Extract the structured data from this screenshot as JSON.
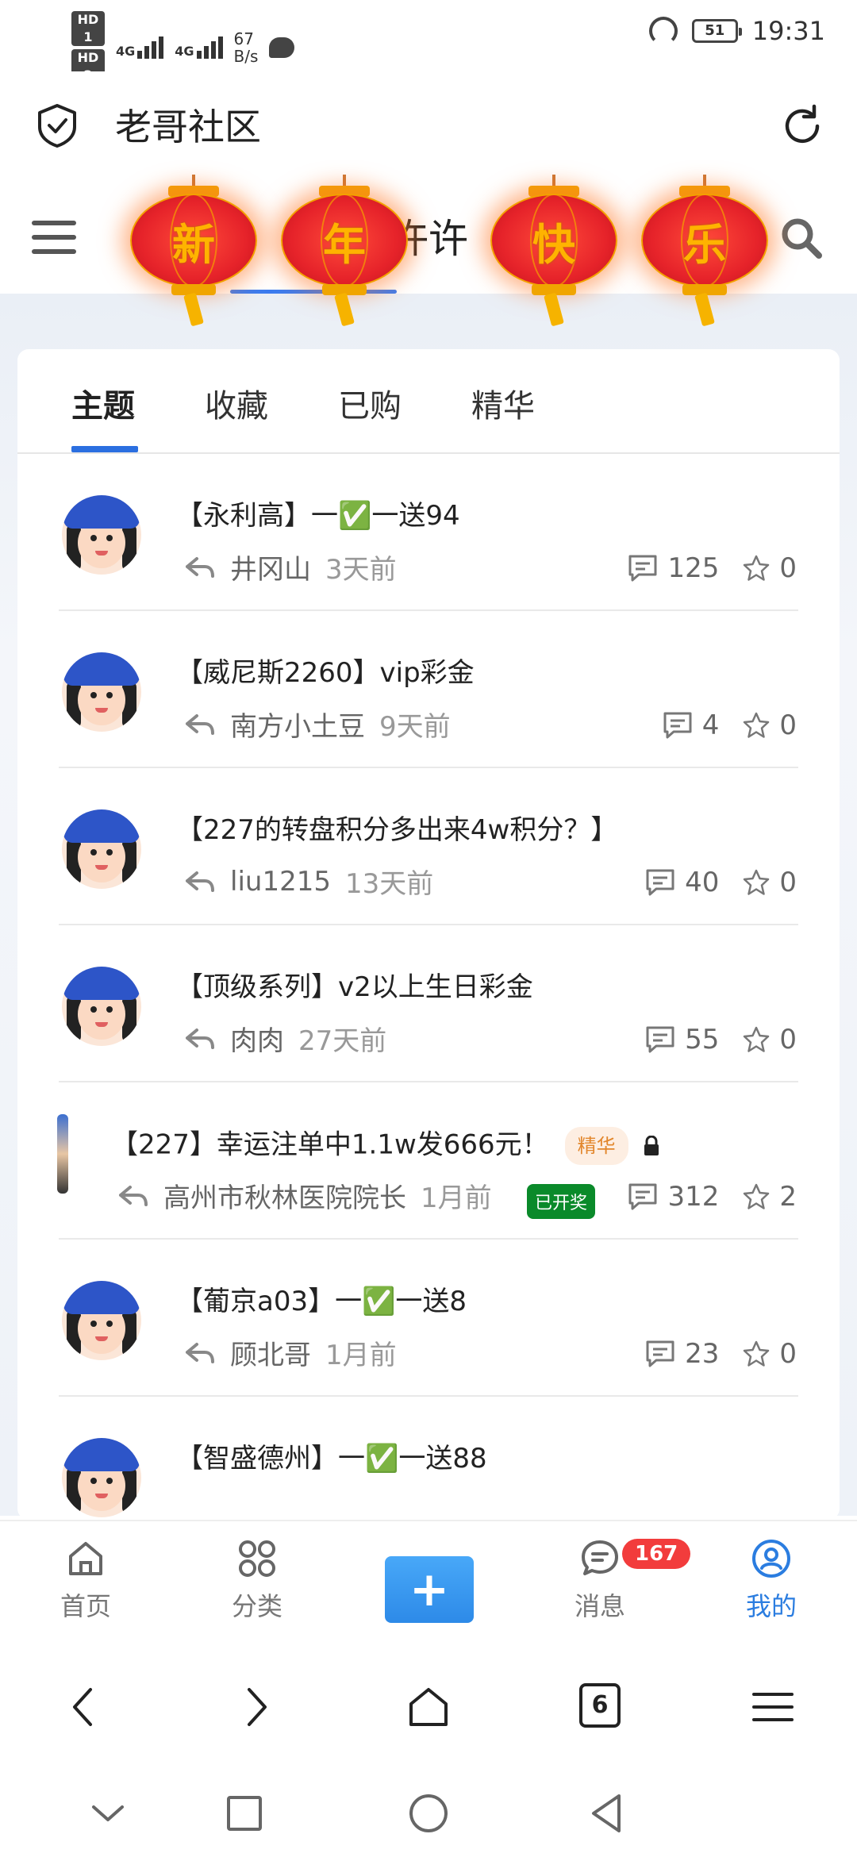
{
  "status_bar": {
    "sim1": "HD 1",
    "sim2": "HD 2",
    "net1": "4G",
    "net2": "4G",
    "speed_value": "67",
    "speed_unit": "B/s",
    "battery": "51",
    "time": "19:31"
  },
  "app": {
    "title": "老哥社区"
  },
  "header": {
    "name_partial": "许许",
    "lanterns": [
      "新",
      "年",
      "快",
      "乐"
    ]
  },
  "tabs": [
    "主题",
    "收藏",
    "已购",
    "精华"
  ],
  "posts": [
    {
      "title": "【永利高】一✅一送94",
      "author": "井冈山",
      "time": "3天前",
      "comments": "125",
      "stars": "0"
    },
    {
      "title": "【威尼斯2260】vip彩金",
      "author": "南方小土豆",
      "time": "9天前",
      "comments": "4",
      "stars": "0"
    },
    {
      "title": "【227的转盘积分多出来4w积分？】",
      "author": "liu1215",
      "time": "13天前",
      "comments": "40",
      "stars": "0"
    },
    {
      "title": "【顶级系列】v2以上生日彩金",
      "author": "肉肉",
      "time": "27天前",
      "comments": "55",
      "stars": "0"
    },
    {
      "title": "【227】幸运注单中1.1w发666元！",
      "badge": "精华",
      "open_badge": "已开奖",
      "author": "高州市秋林医院院长",
      "time": "1月前",
      "comments": "312",
      "stars": "2"
    },
    {
      "title": "【葡京a03】一✅一送8",
      "author": "顾北哥",
      "time": "1月前",
      "comments": "23",
      "stars": "0"
    },
    {
      "title": "【智盛德州】一✅一送88",
      "author": "",
      "time": "",
      "comments": "",
      "stars": ""
    }
  ],
  "tabbar": {
    "home": "首页",
    "category": "分类",
    "messages": "消息",
    "messages_badge": "167",
    "mine": "我的"
  },
  "browser": {
    "tab_count": "6"
  },
  "colors": {
    "accent": "#2b6fe0",
    "badge_red": "#f23c3c",
    "open_green": "#0a8a2a"
  }
}
